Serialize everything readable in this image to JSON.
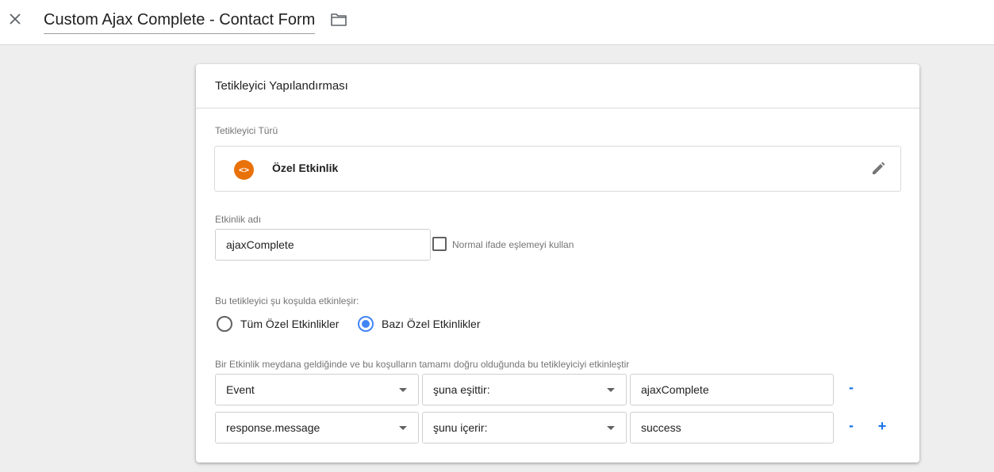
{
  "topbar": {
    "title": "Custom Ajax Complete - Contact Form"
  },
  "card": {
    "title": "Tetikleyici Yapılandırması",
    "trigger_type_label": "Tetikleyici Türü",
    "trigger_type": {
      "icon": "custom-event-icon",
      "icon_glyph": "<>",
      "icon_color": "#e8710a",
      "name": "Özel Etkinlik"
    },
    "event_name_label": "Etkinlik adı",
    "event_name_value": "ajaxComplete",
    "regex_checkbox": {
      "label": "Normal ifade eşlemeyi kullan",
      "checked": false
    },
    "fires_on_label": "Bu tetikleyici şu koşulda etkinleşir:",
    "fires_on_options": [
      {
        "label": "Tüm Özel Etkinlikler",
        "checked": false
      },
      {
        "label": "Bazı Özel Etkinlikler",
        "checked": true
      }
    ],
    "conditions_label": "Bir Etkinlik meydana geldiğinde ve bu koşulların tamamı doğru olduğunda bu tetikleyiciyi etkinleştir",
    "conditions": [
      {
        "variable": "Event",
        "operator": "şuna eşittir:",
        "value": "ajaxComplete"
      },
      {
        "variable": "response.message",
        "operator": "şunu içerir:",
        "value": "success"
      }
    ],
    "remove_label": "-",
    "add_label": "+"
  },
  "colors": {
    "accent": "#4285f4",
    "link_blue": "#1a73e8",
    "custom_event_orange": "#e8710a"
  }
}
